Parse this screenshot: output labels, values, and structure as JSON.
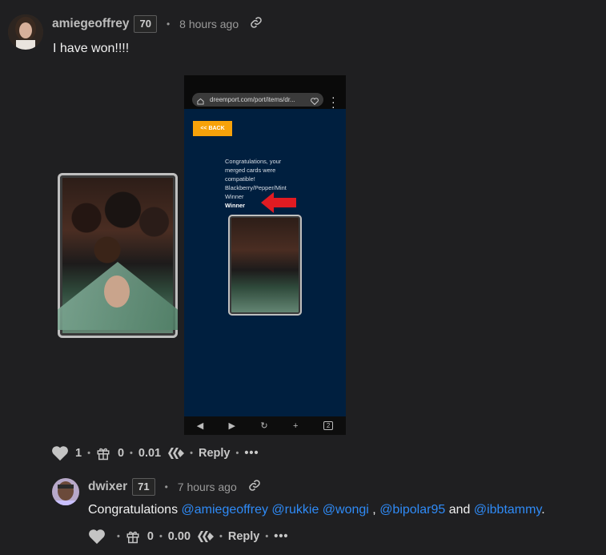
{
  "comments": [
    {
      "author": "amiegeoffrey",
      "reputation": "70",
      "time": "8 hours ago",
      "body": "I have won!!!!",
      "phone": {
        "url": "dreemport.com/port/items/dr...",
        "back_label": "<< BACK",
        "message_line1": "Congratulations, your merged cards were compatible! Blackberry/Pepper/Mint Winner",
        "message_bold": "Winner",
        "tabs_count": "2"
      },
      "actions": {
        "votes": "1",
        "gifts": "0",
        "payout": "0.01",
        "reply": "Reply",
        "more": "•••"
      }
    },
    {
      "author": "dwixer",
      "reputation": "71",
      "time": "7 hours ago",
      "body_prefix": "Congratulations ",
      "mentions": [
        "@amiegeoffrey",
        "@rukkie",
        "@wongi",
        "@bipolar95",
        "@ibbtammy"
      ],
      "body_and": " and ",
      "body_comma": " , ",
      "body_end": ".",
      "actions": {
        "gifts": "0",
        "payout": "0.00",
        "reply": "Reply",
        "more": "•••"
      }
    }
  ]
}
